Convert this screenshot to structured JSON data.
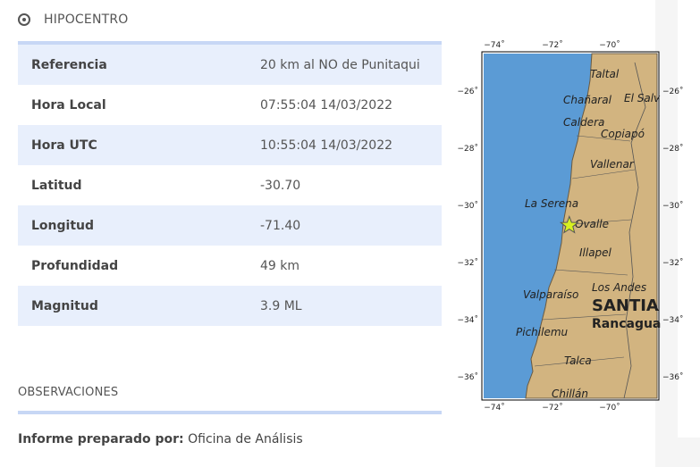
{
  "section": {
    "title": "HIPOCENTRO",
    "icon": "target-icon"
  },
  "details": [
    {
      "key": "Referencia",
      "value": "20 km al NO de Punitaqui"
    },
    {
      "key": "Hora Local",
      "value": "07:55:04 14/03/2022"
    },
    {
      "key": "Hora UTC",
      "value": "10:55:04 14/03/2022"
    },
    {
      "key": "Latitud",
      "value": "-30.70"
    },
    {
      "key": "Longitud",
      "value": "-71.40"
    },
    {
      "key": "Profundidad",
      "value": "49 km"
    },
    {
      "key": "Magnitud",
      "value": "3.9 ML"
    }
  ],
  "observations": {
    "title": "OBSERVACIONES",
    "report_label": "Informe preparado por:",
    "report_value": "Oficina de Análisis"
  },
  "map": {
    "lon_ticks": [
      "−74˚",
      "−72˚",
      "−70˚"
    ],
    "lat_ticks": [
      "−26˚",
      "−28˚",
      "−30˚",
      "−32˚",
      "−34˚",
      "−36˚"
    ],
    "places": [
      "Taltal",
      "Chañaral",
      "El Salv",
      "Caldera",
      "Copiapó",
      "Vallenar",
      "La Serena",
      "Ovalle",
      "Illapel",
      "Valparaíso",
      "Los Andes",
      "SANTIA",
      "Rancagua",
      "Pichilemu",
      "Talca",
      "Chillán"
    ],
    "colors": {
      "ocean": "#5b9bd5",
      "land": "#d2b480",
      "epicenter": "#d8f020"
    },
    "epicenter": {
      "lat": -30.7,
      "lon": -71.4
    }
  }
}
